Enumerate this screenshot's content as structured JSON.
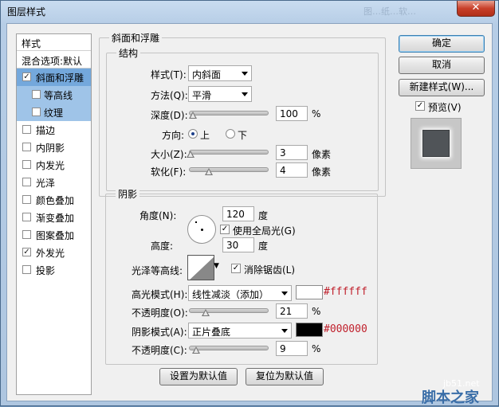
{
  "window": {
    "title": "图层样式",
    "ghost_title": "图…纸…软…",
    "close_glyph": "✕"
  },
  "left_panel": {
    "header": "样式",
    "blend_options": "混合选项:默认",
    "items": [
      {
        "label": "斜面和浮雕",
        "checked": true,
        "selected": true,
        "sub": false
      },
      {
        "label": "等高线",
        "checked": false,
        "selected": true,
        "sub": true
      },
      {
        "label": "纹理",
        "checked": false,
        "selected": true,
        "sub": true
      },
      {
        "label": "描边",
        "checked": false,
        "selected": false,
        "sub": false
      },
      {
        "label": "内阴影",
        "checked": false,
        "selected": false,
        "sub": false
      },
      {
        "label": "内发光",
        "checked": false,
        "selected": false,
        "sub": false
      },
      {
        "label": "光泽",
        "checked": false,
        "selected": false,
        "sub": false
      },
      {
        "label": "颜色叠加",
        "checked": false,
        "selected": false,
        "sub": false
      },
      {
        "label": "渐变叠加",
        "checked": false,
        "selected": false,
        "sub": false
      },
      {
        "label": "图案叠加",
        "checked": false,
        "selected": false,
        "sub": false
      },
      {
        "label": "外发光",
        "checked": true,
        "selected": false,
        "sub": false
      },
      {
        "label": "投影",
        "checked": false,
        "selected": false,
        "sub": false
      }
    ]
  },
  "bevel": {
    "group_title": "斜面和浮雕",
    "structure_title": "结构",
    "style_label": "样式(T):",
    "style_value": "内斜面",
    "technique_label": "方法(Q):",
    "technique_value": "平滑",
    "depth_label": "深度(D):",
    "depth_value": "100",
    "depth_unit": "%",
    "depth_pos": 0.05,
    "direction_label": "方向:",
    "dir_up": "上",
    "dir_down": "下",
    "size_label": "大小(Z):",
    "size_value": "3",
    "size_unit": "像素",
    "size_pos": 0.02,
    "soften_label": "软化(F):",
    "soften_value": "4",
    "soften_unit": "像素",
    "soften_pos": 0.25
  },
  "shading": {
    "group_title": "阴影",
    "angle_label": "角度(N):",
    "angle_value": "120",
    "angle_unit": "度",
    "global_light_label": "使用全局光(G)",
    "altitude_label": "高度:",
    "altitude_value": "30",
    "altitude_unit": "度",
    "gloss_label": "光泽等高线:",
    "antialias_label": "消除锯齿(L)",
    "highlight_label": "高光模式(H):",
    "highlight_mode": "线性减淡（添加）",
    "highlight_color": "#ffffff",
    "highlight_hex": "#ffffff",
    "hl_opacity_label": "不透明度(O):",
    "hl_opacity_value": "21",
    "hl_opacity_unit": "%",
    "hl_opacity_pos": 0.21,
    "shadow_label": "阴影模式(A):",
    "shadow_mode": "正片叠底",
    "shadow_color": "#000000",
    "shadow_hex": "#000000",
    "sh_opacity_label": "不透明度(C):",
    "sh_opacity_value": "9",
    "sh_opacity_unit": "%",
    "sh_opacity_pos": 0.09
  },
  "buttons": {
    "ok": "确定",
    "cancel": "取消",
    "new_style": "新建样式(W)...",
    "preview_label": "预览(V)",
    "make_default": "设置为默认值",
    "reset_default": "复位为默认值"
  },
  "watermark": {
    "site": "jb51.net",
    "brand": "脚本之家"
  }
}
